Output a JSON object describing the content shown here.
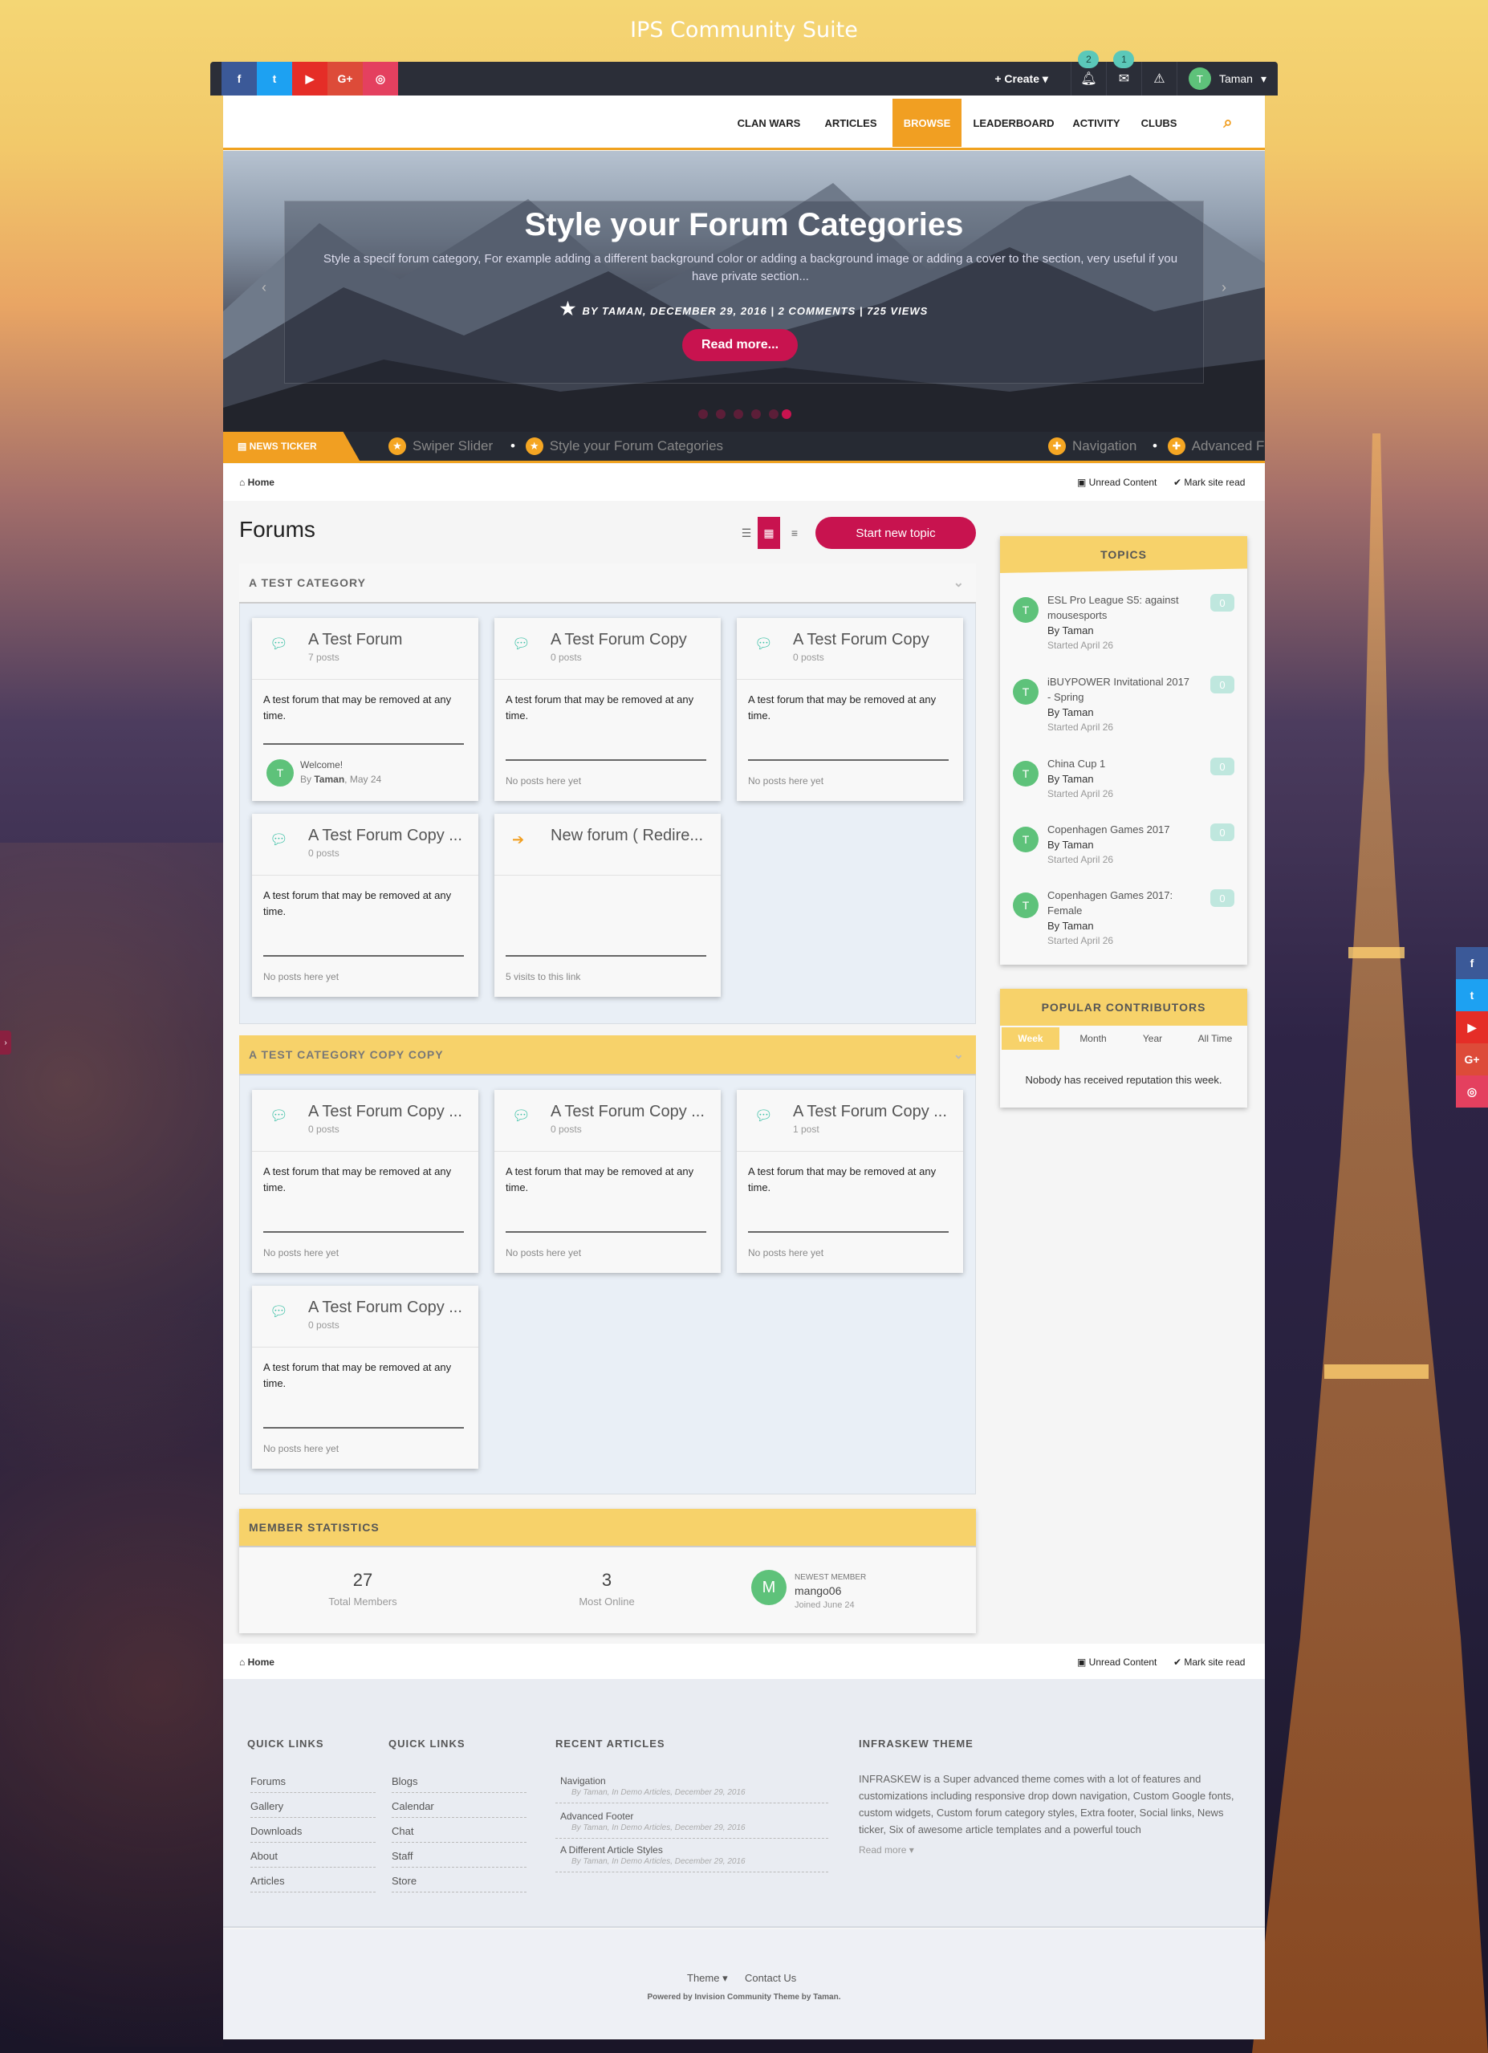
{
  "site_title": "IPS Community Suite",
  "topbar": {
    "social": [
      "f",
      "t",
      "▶",
      "G+",
      "◎"
    ],
    "create_label": "Create",
    "notifications_count": "2",
    "messages_count": "1",
    "user_initial": "T",
    "user_name": "Taman"
  },
  "nav": {
    "items": [
      "CLAN WARS",
      "ARTICLES",
      "BROWSE",
      "LEADERBOARD",
      "ACTIVITY",
      "CLUBS"
    ],
    "active": "BROWSE"
  },
  "hero": {
    "title": "Style your Forum Categories",
    "text": "Style a specif forum category, For example adding a different background color or adding a background image or adding a cover to the section, very useful if you have private section...",
    "meta": "BY TAMAN, DECEMBER 29, 2016  |  2 COMMENTS  |  725 VIEWS",
    "read_more": "Read more..."
  },
  "ticker": {
    "label": "NEWS TICKER",
    "items": [
      "Swiper Slider",
      "Style your Forum Categories",
      "Navigation",
      "Advanced F"
    ]
  },
  "breadcrumb": {
    "home": "Home",
    "unread": "Unread Content",
    "mark_read": "Mark site read"
  },
  "forums": {
    "title": "Forums",
    "start_topic": "Start new topic",
    "categories": [
      {
        "name": "A TEST CATEGORY",
        "forums": [
          {
            "name": "A Test Forum",
            "posts": "7 posts",
            "desc": "A test forum that may be removed at any time.",
            "last_title": "Welcome!",
            "last_by": "By",
            "last_author": "Taman",
            "last_date": ", May 24",
            "avatar": "T"
          },
          {
            "name": "A Test Forum Copy",
            "posts": "0 posts",
            "desc": "A test forum that may be removed at any time.",
            "footer": "No posts here yet"
          },
          {
            "name": "A Test Forum Copy",
            "posts": "0 posts",
            "desc": "A test forum that may be removed at any time.",
            "footer": "No posts here yet"
          },
          {
            "name": "A Test Forum Copy ...",
            "posts": "0 posts",
            "desc": "A test forum that may be removed at any time.",
            "footer": "No posts here yet"
          },
          {
            "name": "New forum ( Redire...",
            "posts": "",
            "desc": "",
            "footer": "5 visits to this link"
          }
        ]
      },
      {
        "name": "A TEST CATEGORY COPY COPY",
        "forums": [
          {
            "name": "A Test Forum Copy ...",
            "posts": "0 posts",
            "desc": "A test forum that may be removed at any time.",
            "footer": "No posts here yet"
          },
          {
            "name": "A Test Forum Copy ...",
            "posts": "0 posts",
            "desc": "A test forum that may be removed at any time.",
            "footer": "No posts here yet"
          },
          {
            "name": "A Test Forum Copy ...",
            "posts": "1 post",
            "desc": "A test forum that may be removed at any time.",
            "footer": "No posts here yet"
          },
          {
            "name": "A Test Forum Copy ...",
            "posts": "0 posts",
            "desc": "A test forum that may be removed at any time.",
            "footer": "No posts here yet"
          }
        ]
      }
    ]
  },
  "member_stats": {
    "title": "MEMBER STATISTICS",
    "total_members": "27",
    "total_members_label": "Total Members",
    "most_online": "3",
    "most_online_label": "Most Online",
    "newest_label": "NEWEST MEMBER",
    "newest_name": "mango06",
    "newest_joined": "Joined June 24",
    "newest_initial": "M"
  },
  "topics_widget": {
    "title": "TOPICS",
    "topics": [
      {
        "title": "ESL Pro League S5: against mousesports",
        "by": "By Taman",
        "started": "Started April 26",
        "count": "0"
      },
      {
        "title": "iBUYPOWER Invitational 2017 - Spring",
        "by": "By Taman",
        "started": "Started April 26",
        "count": "0"
      },
      {
        "title": "China Cup 1",
        "by": "By Taman",
        "started": "Started April 26",
        "count": "0"
      },
      {
        "title": "Copenhagen Games 2017",
        "by": "By Taman",
        "started": "Started April 26",
        "count": "0"
      },
      {
        "title": "Copenhagen Games 2017: Female",
        "by": "By Taman",
        "started": "Started April 26",
        "count": "0"
      }
    ]
  },
  "contributors_widget": {
    "title": "POPULAR CONTRIBUTORS",
    "tabs": [
      "Week",
      "Month",
      "Year",
      "All Time"
    ],
    "active_tab": "Week",
    "empty": "Nobody has received reputation this week."
  },
  "footer": {
    "quick_links_1": {
      "title": "QUICK LINKS",
      "links": [
        "Forums",
        "Gallery",
        "Downloads",
        "About",
        "Articles"
      ]
    },
    "quick_links_2": {
      "title": "QUICK LINKS",
      "links": [
        "Blogs",
        "Calendar",
        "Chat",
        "Staff",
        "Store"
      ]
    },
    "recent_articles": {
      "title": "RECENT ARTICLES",
      "items": [
        {
          "title": "Navigation",
          "meta": "By Taman, In Demo Articles, December 29, 2016"
        },
        {
          "title": "Advanced Footer",
          "meta": "By Taman, In Demo Articles, December 29, 2016"
        },
        {
          "title": "A Different Article Styles",
          "meta": "By Taman, In Demo Articles, December 29, 2016"
        }
      ]
    },
    "about": {
      "title": "INFRASKEW THEME",
      "text": "INFRASKEW is a Super advanced theme comes with a lot of features and customizations including responsive drop down navigation, Custom Google fonts, custom widgets, Custom forum category styles, Extra footer, Social links, News ticker, Six of awesome article templates and a powerful touch",
      "read_more": "Read more"
    },
    "theme_label": "Theme",
    "contact_label": "Contact Us",
    "powered": "Powered by Invision Community Theme by Taman."
  },
  "colors": {
    "accent": "#f19f22",
    "primary": "#c8134f",
    "category_header": "#f7d26a",
    "avatar": "#5ec27a"
  }
}
